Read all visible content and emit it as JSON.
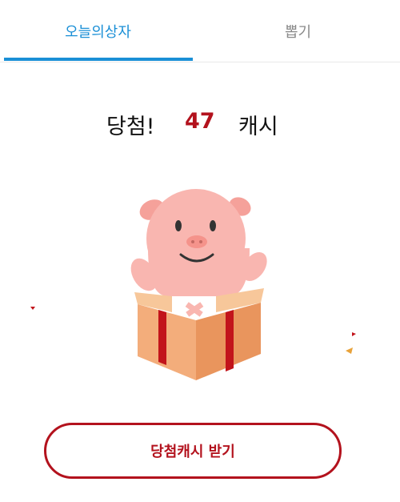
{
  "tabs": [
    {
      "label": "오늘의상자",
      "active": true
    },
    {
      "label": "뽑기",
      "active": false
    }
  ],
  "result": {
    "win_label": "당첨!",
    "amount": "47",
    "cash_label": "캐시"
  },
  "illustration": {
    "icon": "pig-in-gift-box-icon",
    "colors": {
      "pig": "#f9b6b0",
      "box": "#f1a874",
      "ribbon": "#c2141b",
      "confetti": [
        "#c2141b",
        "#e8a23a"
      ]
    }
  },
  "claim_button": {
    "label": "당첨캐시 받기",
    "color": "#b3121d"
  },
  "colors": {
    "accent": "#1a8fd6",
    "win": "#b3121d"
  }
}
